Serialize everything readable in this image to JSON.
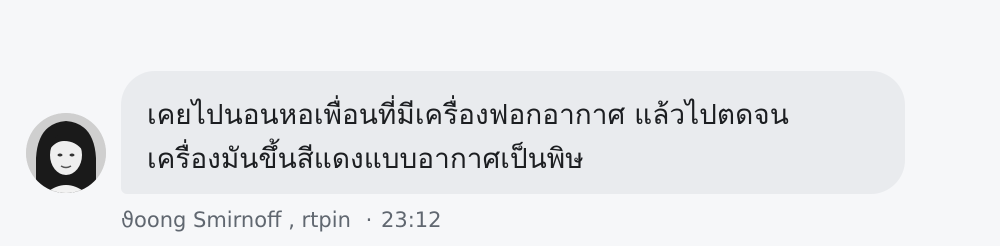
{
  "message": {
    "author": "ϑoong Smirnoff , rtpin",
    "separator": "·",
    "time": "23:12",
    "lines": [
      "เคยไปนอนหอเพื่อนที่มีเครื่องฟอกอากาศ แล้วไปตดจน",
      "เครื่องมันขึ้นสีแดงแบบอากาศเป็นพิษ"
    ]
  },
  "colors": {
    "page_background": "#f6f7f9",
    "bubble_background": "#e9ebee",
    "text": "#1c1e21",
    "meta_text": "#606770"
  }
}
